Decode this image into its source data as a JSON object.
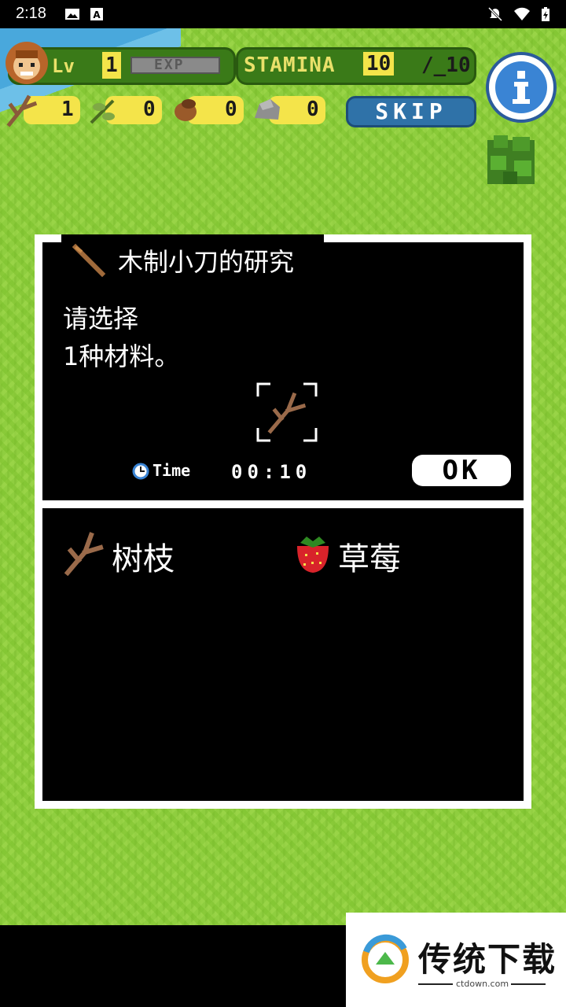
{
  "status_bar": {
    "time": "2:18"
  },
  "hud": {
    "level_label": "Lv",
    "level": "1",
    "exp_label": "EXP",
    "stamina_label": "STAMINA",
    "stamina_current": "10",
    "stamina_max": "/_10",
    "resources": [
      {
        "name": "branch-icon",
        "count": "1"
      },
      {
        "name": "leaf-icon",
        "count": "0"
      },
      {
        "name": "nut-icon",
        "count": "0"
      },
      {
        "name": "stone-icon",
        "count": "0"
      }
    ],
    "skip_label": "SKIP"
  },
  "dialog": {
    "title": "木制小刀的研究",
    "prompt_line1": "请选择",
    "prompt_line2": "1种材料。",
    "time_label": "Time",
    "time_value": "00:10",
    "ok_label": "OK",
    "materials": [
      {
        "label": "树枝",
        "icon": "branch-icon"
      },
      {
        "label": "草莓",
        "icon": "strawberry-icon"
      }
    ]
  },
  "watermark": {
    "brand": "传统下载",
    "url": "ctdown.com"
  },
  "colors": {
    "grass": "#8fce3f",
    "hud_green": "#3a7a18",
    "hud_yellow": "#f4e44a",
    "skip_blue": "#2f72a8",
    "info_blue": "#3a84d4"
  }
}
